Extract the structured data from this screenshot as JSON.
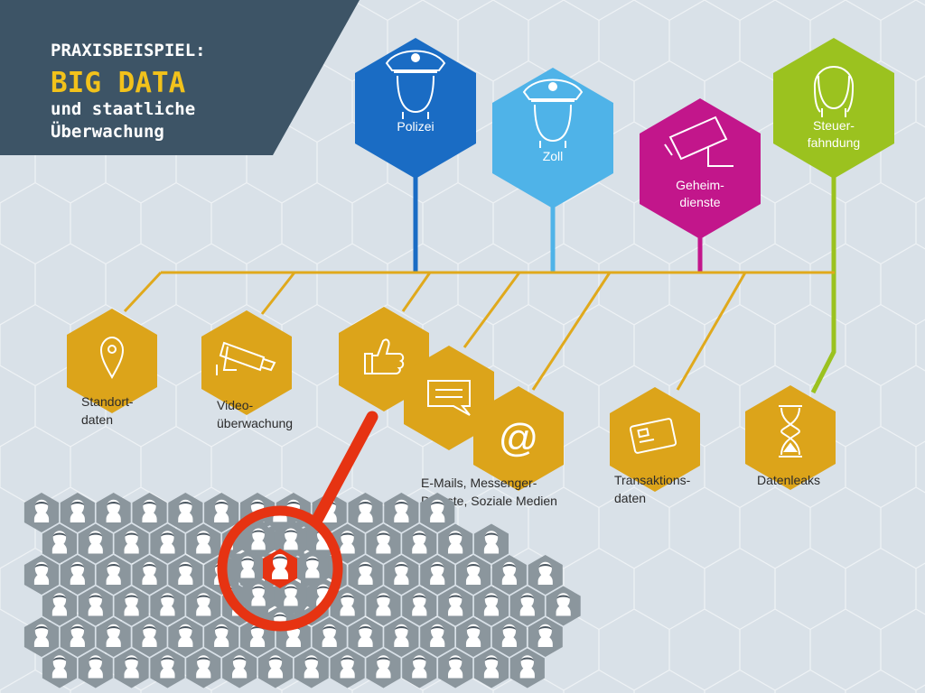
{
  "header": {
    "kicker": "PRAXISBEISPIEL:",
    "title": "BIG DATA",
    "subtitle_line1": "und staatliche",
    "subtitle_line2": "Überwachung"
  },
  "agencies": [
    {
      "id": "polizei",
      "label": "Polizei",
      "color": "#1a6cc4",
      "icon": "police-officer-icon"
    },
    {
      "id": "zoll",
      "label": "Zoll",
      "color": "#4fb3e8",
      "icon": "customs-officer-icon"
    },
    {
      "id": "geheimdienste",
      "line1": "Geheim-",
      "line2": "dienste",
      "color": "#c2168b",
      "icon": "surveillance-camera-icon"
    },
    {
      "id": "steuerfahndung",
      "line1": "Steuer-",
      "line2": "fahndung",
      "color": "#9bc21f",
      "icon": "tax-investigator-icon"
    }
  ],
  "sources": [
    {
      "id": "standortdaten",
      "line1": "Standort-",
      "line2": "daten",
      "icon": "location-pin-icon"
    },
    {
      "id": "videoueberwachung",
      "line1": "Video-",
      "line2": "überwachung",
      "icon": "cctv-camera-icon"
    },
    {
      "id": "likes",
      "icon": "thumbs-up-icon"
    },
    {
      "id": "messenger",
      "icon": "chat-bubble-icon"
    },
    {
      "id": "email",
      "icon": "at-sign-icon"
    },
    {
      "id": "emails_caption",
      "line1": "E-Mails, Messenger-",
      "line2": "Dienste, Soziale Medien"
    },
    {
      "id": "transaktionsdaten",
      "line1": "Transaktions-",
      "line2": "daten",
      "icon": "credit-card-icon"
    },
    {
      "id": "datenleaks",
      "label": "Datenleaks",
      "icon": "hourglass-icon"
    }
  ],
  "colors": {
    "background": "#d9e1e8",
    "header_bg": "#3d5466",
    "title": "#f2c21b",
    "data_hex": "#dca41a",
    "bus_line": "#e0a91c",
    "crowd_hex": "#8b969d",
    "magnifier": "#e63312"
  }
}
